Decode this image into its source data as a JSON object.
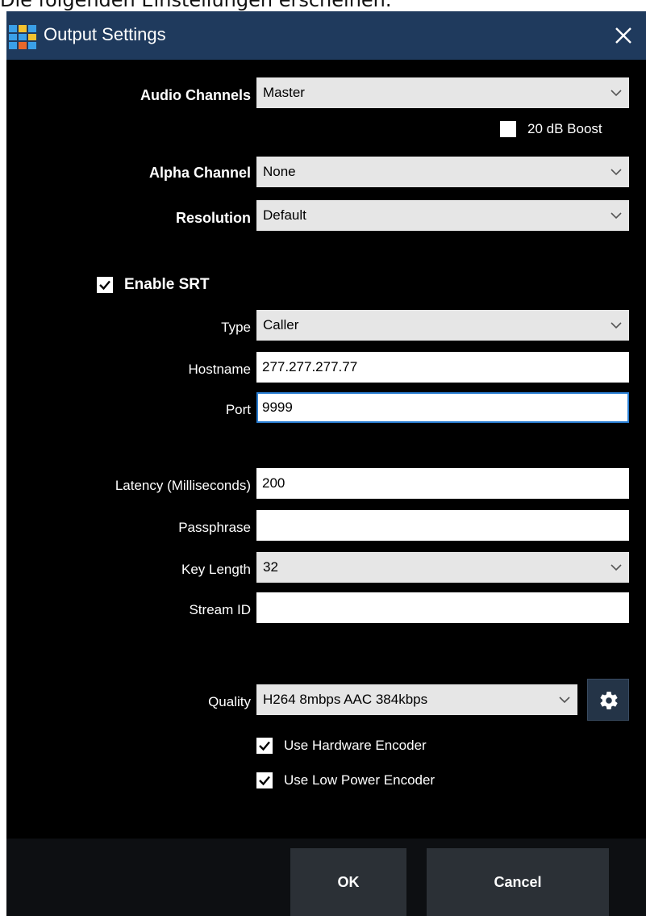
{
  "caption": "Die folgenden Einstellungen erscheinen.",
  "window": {
    "title": "Output Settings",
    "icon": "grid-app-icon",
    "close_icon": "close-icon",
    "icon_colors": [
      "#3aa0e8",
      "#f2c12e",
      "#3aa0e8",
      "#3aa0e8",
      "#3aa0e8",
      "#f2c12e",
      "#3aa0e8",
      "#e8682a",
      "#3aa0e8"
    ]
  },
  "audio": {
    "channels_label": "Audio Channels",
    "channels_value": "Master",
    "boost_label": "20 dB Boost",
    "boost_checked": false
  },
  "alpha": {
    "label": "Alpha Channel",
    "value": "None"
  },
  "resolution": {
    "label": "Resolution",
    "value": "Default"
  },
  "srt": {
    "enable_label": "Enable SRT",
    "enabled": true,
    "type_label": "Type",
    "type_value": "Caller",
    "hostname_label": "Hostname",
    "hostname_value": "277.277.277.77",
    "port_label": "Port",
    "port_value": "9999",
    "latency_label": "Latency (Milliseconds)",
    "latency_value": "200",
    "passphrase_label": "Passphrase",
    "passphrase_value": "",
    "key_length_label": "Key Length",
    "key_length_value": "32",
    "stream_id_label": "Stream ID",
    "stream_id_value": ""
  },
  "quality": {
    "label": "Quality",
    "value": "H264 8mbps AAC 384kbps",
    "settings_icon": "gear-icon",
    "hw_encoder_label": "Use Hardware Encoder",
    "hw_encoder_checked": true,
    "low_power_label": "Use Low Power Encoder",
    "low_power_checked": true
  },
  "buttons": {
    "ok": "OK",
    "cancel": "Cancel"
  },
  "colors": {
    "titlebar": "#1f3a5d",
    "dialog_bg": "#000000",
    "select_bg": "#e6e6e6",
    "focus": "#2a7fd4",
    "button_bg": "#2b3036"
  }
}
